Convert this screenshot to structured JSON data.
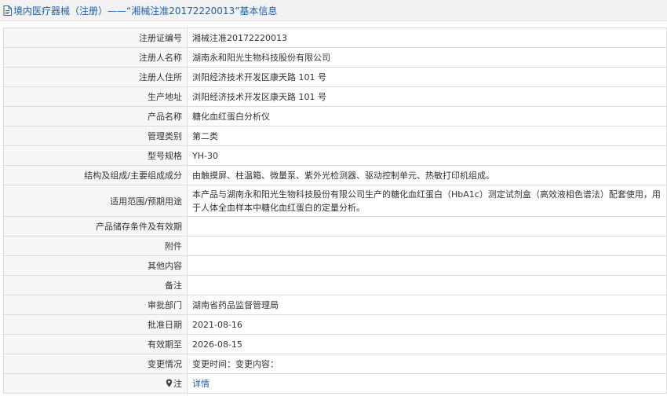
{
  "header": {
    "title": "境内医疗器械（注册）——“湘械注准20172220013”基本信息"
  },
  "rows": [
    {
      "label": "注册证编号",
      "value": "湘械注准20172220013"
    },
    {
      "label": "注册人名称",
      "value": "湖南永和阳光生物科技股份有限公司"
    },
    {
      "label": "注册人住所",
      "value": "浏阳经济技术开发区康天路 101 号"
    },
    {
      "label": "生产地址",
      "value": "浏阳经济技术开发区康天路 101 号"
    },
    {
      "label": "产品名称",
      "value": "糖化血红蛋白分析仪"
    },
    {
      "label": "管理类别",
      "value": "第二类"
    },
    {
      "label": "型号规格",
      "value": "YH-30"
    },
    {
      "label": "结构及组成/主要组成成分",
      "value": "由触摸屏、柱温箱、微量泵、紫外光检测器、驱动控制单元、热敏打印机组成。"
    },
    {
      "label": "适用范围/预期用途",
      "value": "本产品与湖南永和阳光生物科技股份有限公司生产的糖化血红蛋白（HbA1c）测定试剂盒（高效液相色谱法）配套使用，用于人体全血样本中糖化血红蛋白的定量分析。"
    },
    {
      "label": "产品储存条件及有效期",
      "value": ""
    },
    {
      "label": "附件",
      "value": ""
    },
    {
      "label": "其他内容",
      "value": ""
    },
    {
      "label": "备注",
      "value": ""
    },
    {
      "label": "审批部门",
      "value": "湖南省药品监督管理局"
    },
    {
      "label": "批准日期",
      "value": "2021-08-16"
    },
    {
      "label": "有效期至",
      "value": "2026-08-15"
    },
    {
      "label": "变更情况",
      "value": "变更时间：变更内容："
    }
  ],
  "note": {
    "label": "注",
    "link": "详情"
  },
  "icons": {
    "header_icon": "document-icon",
    "note_icon": "map-pin-icon"
  }
}
